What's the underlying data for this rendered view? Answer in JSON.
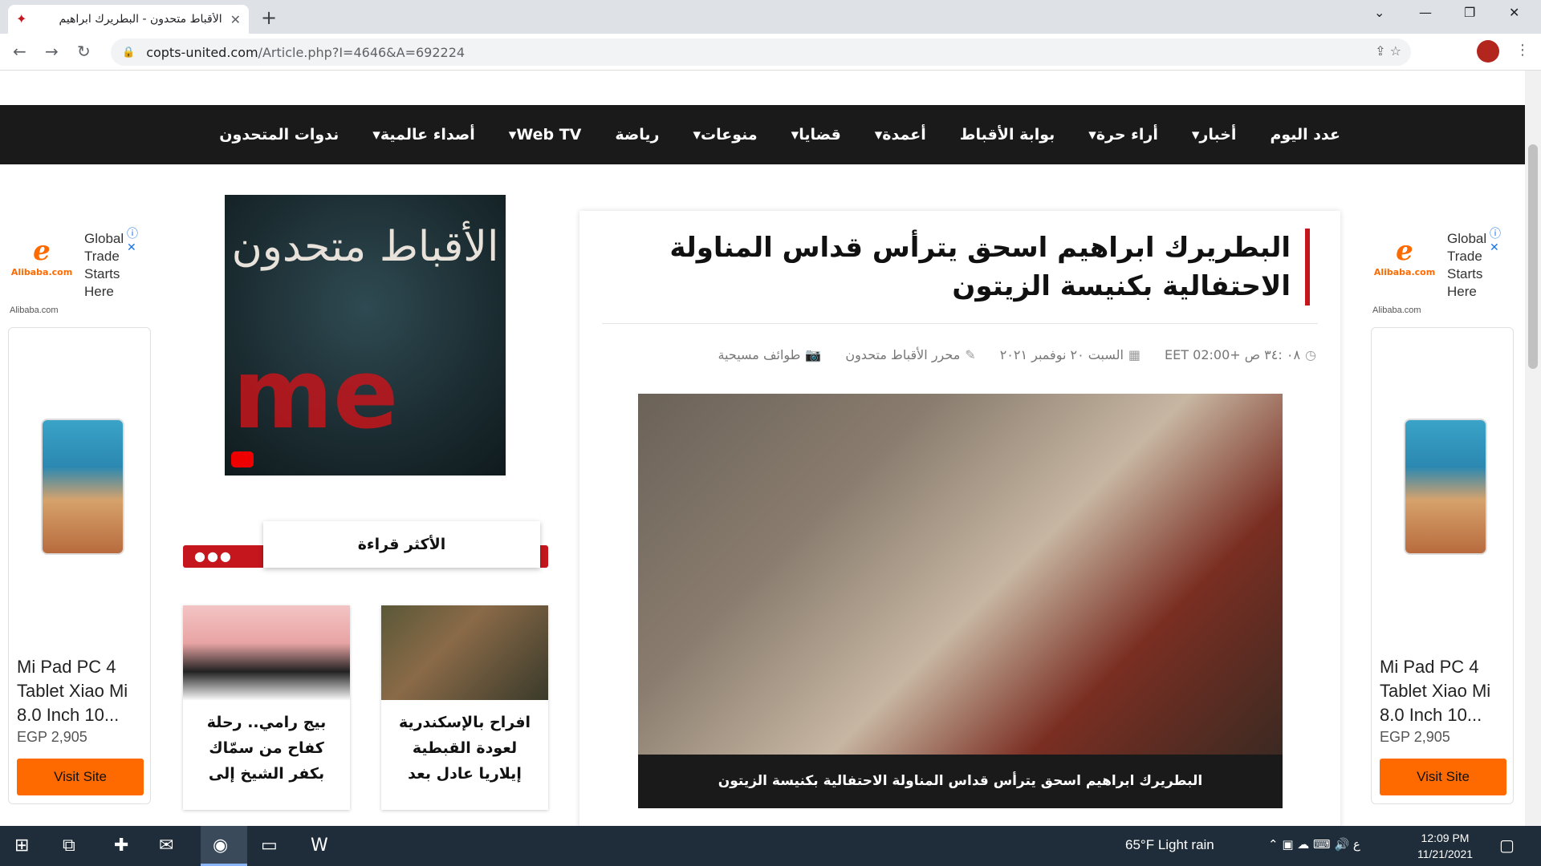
{
  "browser": {
    "tab_title": "الأقباط متحدون - البطريرك ابراهيم",
    "url_domain": "copts-united.com",
    "url_path": "/Article.php?I=4646&A=692224"
  },
  "nav": {
    "items": [
      "عدد اليوم",
      "أخبار▾",
      "أراء حرة▾",
      "بوابة الأقباط",
      "أعمدة▾",
      "قضايا▾",
      "منوعات▾",
      "رياضة",
      "Web TV▾",
      "أصداء عالمية▾",
      "ندوات المتحدون"
    ]
  },
  "ads": {
    "tagline_lines": [
      "Global",
      "Trade",
      "Starts",
      "Here"
    ],
    "logo_text": "Alibaba.com",
    "domain": "Alibaba.com",
    "product_title": "Mi Pad PC 4 Tablet Xiao Mi 8.0 Inch 10...",
    "price": "EGP 2,905",
    "cta": "Visit Site",
    "accent_color": "#ff6a00"
  },
  "video": {
    "title": "الأقباط متحدون"
  },
  "most_read": {
    "heading": "الأكثر قراءة",
    "dots": "●●●",
    "cards": [
      {
        "text": "افراح بالإسكندرية لعودة القبطية إيلاريا عادل بعد"
      },
      {
        "text": "بيج رامي.. رحلة كفاح من سمّاك بكفر الشيخ إلى"
      }
    ]
  },
  "article": {
    "title": "البطريرك ابراهيم اسحق يترأس قداس المناولة الاحتفالية بكنيسة الزيتون",
    "category": "طوائف مسيحية",
    "author": "محرر الأقباط متحدون",
    "date": "السبت ٢٠ نوفمبر ٢٠٢١",
    "time": "٠٨ :٣٤ ص +02:00 EET",
    "caption": "البطريرك ابراهيم اسحق يترأس قداس المناولة الاحتفالية بكنيسة الزيتون",
    "accent_color": "#c4161c"
  },
  "taskbar": {
    "weather": "65°F  Light rain",
    "time": "12:09 PM",
    "date": "11/21/2021",
    "lang": "ع"
  }
}
